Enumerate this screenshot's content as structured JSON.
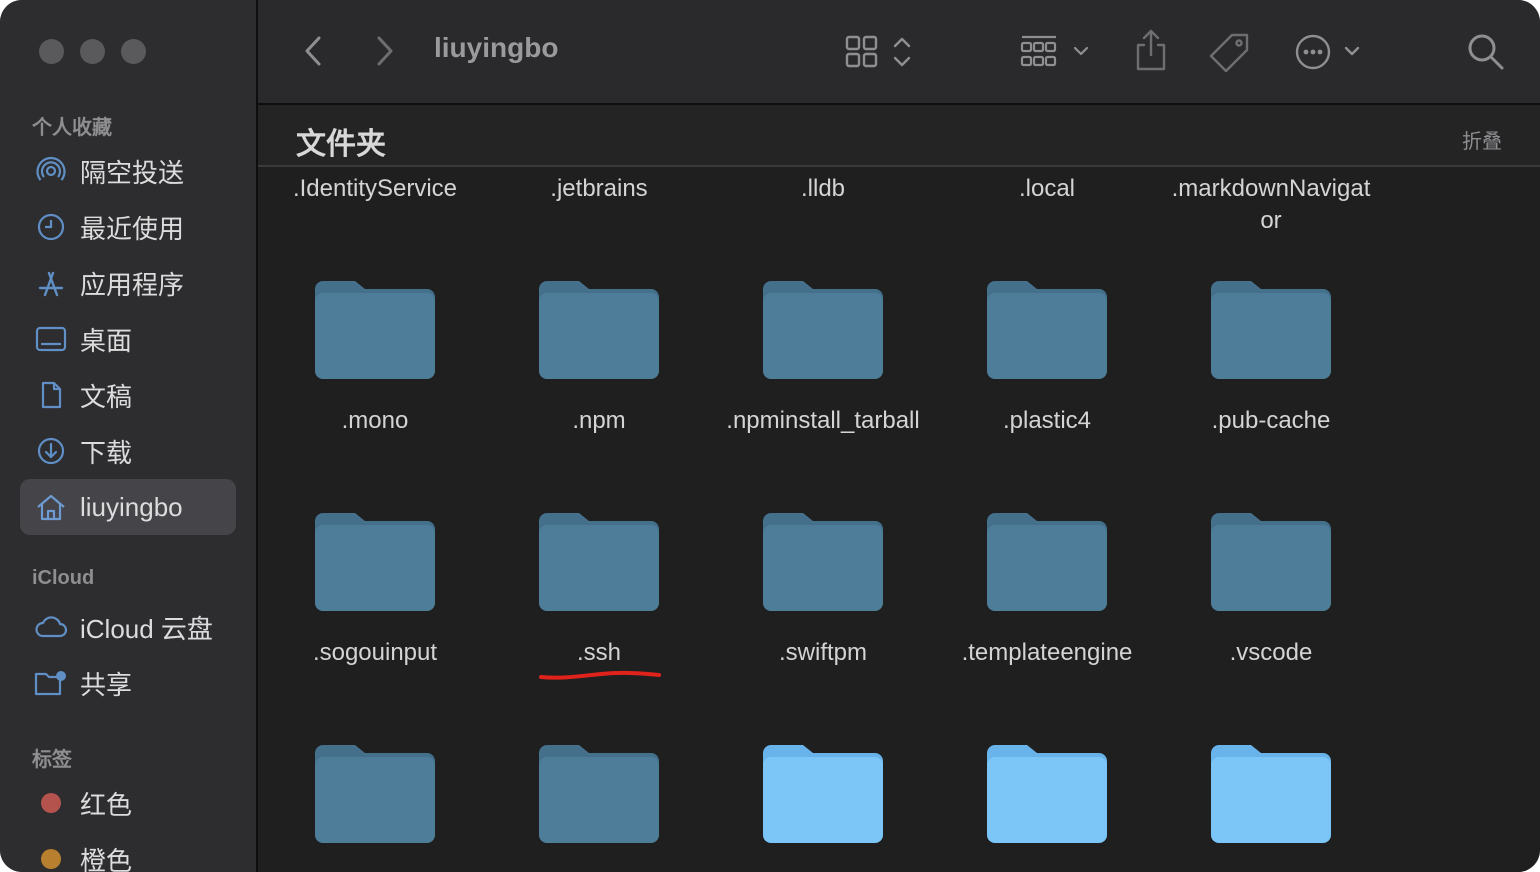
{
  "window": {
    "title": "liuyingbo"
  },
  "sidebar": {
    "sections": {
      "favorites": "个人收藏",
      "icloud": "iCloud",
      "tags": "标签"
    },
    "favorites": [
      {
        "label": "隔空投送",
        "icon": "airdrop-icon"
      },
      {
        "label": "最近使用",
        "icon": "clock-icon"
      },
      {
        "label": "应用程序",
        "icon": "applications-icon"
      },
      {
        "label": "桌面",
        "icon": "desktop-icon"
      },
      {
        "label": "文稿",
        "icon": "document-icon"
      },
      {
        "label": "下载",
        "icon": "download-icon"
      },
      {
        "label": "liuyingbo",
        "icon": "home-icon",
        "selected": true
      }
    ],
    "icloud": [
      {
        "label": "iCloud 云盘",
        "icon": "cloud-icon"
      },
      {
        "label": "共享",
        "icon": "shared-folder-icon"
      }
    ],
    "tags": [
      {
        "label": "红色",
        "color": "#b4524e"
      },
      {
        "label": "橙色",
        "color": "#b77f2e"
      }
    ]
  },
  "toolbar": {
    "back_icon": "chevron-left-icon",
    "forward_icon": "chevron-right-icon",
    "view_icon": "grid-view-icon",
    "group_icon": "group-icon",
    "share_icon": "share-icon",
    "tag_icon": "tag-icon",
    "more_icon": "ellipsis-circle-icon",
    "search_icon": "search-icon"
  },
  "content": {
    "section_title": "文件夹",
    "collapse_label": "折叠",
    "top_row": [
      ".IdentityService",
      ".jetbrains",
      ".lldb",
      ".local",
      ".markdownNavigator"
    ],
    "rows": [
      [
        ".mono",
        ".npm",
        ".npminstall_tarball",
        ".plastic4",
        ".pub-cache"
      ],
      [
        ".sogouinput",
        ".ssh",
        ".swiftpm",
        ".templateengine",
        ".vscode"
      ]
    ],
    "colors": {
      "hidden_folder": "#4e7d99",
      "hidden_folder_tab": "#44708b",
      "folder": "#7cc5f7",
      "folder_tab": "#67b3ea",
      "annotation": "#e0221c"
    }
  }
}
